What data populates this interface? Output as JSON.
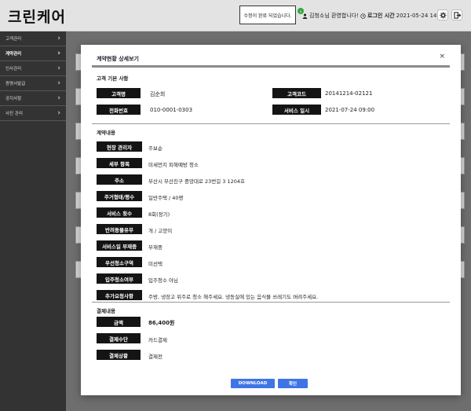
{
  "app": {
    "title": "크린케어"
  },
  "toast": {
    "message": "수정이 완료 되었습니다.",
    "dot": "x"
  },
  "header": {
    "user": "김청소님 환영합니다!",
    "login_label": "로그인 시간",
    "login_time": "2021-05-24 14:17"
  },
  "sidebar": {
    "items": [
      {
        "label": "고객관리"
      },
      {
        "label": "계약관리"
      },
      {
        "label": "인사관리"
      },
      {
        "label": "증명서발급"
      },
      {
        "label": "공지사항"
      },
      {
        "label": "사진 관리"
      }
    ]
  },
  "modal": {
    "title": "계약현황 상세보기",
    "close": "×",
    "section_customer": "고객 기본 사항",
    "customer": {
      "name_label": "고객명",
      "name": "김순희",
      "code_label": "고객코드",
      "code": "20141214-02121",
      "phone_label": "전화번호",
      "phone": "010-0001-0303",
      "date_label": "서비스 일시",
      "date": "2021-07-24 09:00"
    },
    "section_contract": "계약내용",
    "contract": [
      {
        "label": "현장 관리자",
        "value": "주보순"
      },
      {
        "label": "세부 항목",
        "value": "미세먼지 피해예방 청소"
      },
      {
        "label": "주소",
        "value": "부산시 부산진구 중앙대로 23번길 3 1204호"
      },
      {
        "label": "주거형태/평수",
        "value": "일반주택 / 40평"
      },
      {
        "label": "서비스 횟수",
        "value": "8회(정기)"
      },
      {
        "label": "반려동물유무",
        "value": "개 / 고양이"
      },
      {
        "label": "서비스일 부재중",
        "value": "부재중"
      },
      {
        "label": "우선청소구역",
        "value": "미선택"
      },
      {
        "label": "입주청소여부",
        "value": "입주청소 아님"
      },
      {
        "label": "추가요청사항",
        "value": "주방, 냉장고 위주로 청소 해주세요. 냉동실에 있는 음식물 쓰레기도 버려주세요."
      }
    ],
    "section_payment": "결제내용",
    "payment": [
      {
        "label": "금액",
        "value": "86,400원"
      },
      {
        "label": "결제수단",
        "value": "카드결제"
      },
      {
        "label": "결제상황",
        "value": "결제전"
      }
    ],
    "download_label": "DOWNLOAD",
    "confirm_label": "확인"
  }
}
